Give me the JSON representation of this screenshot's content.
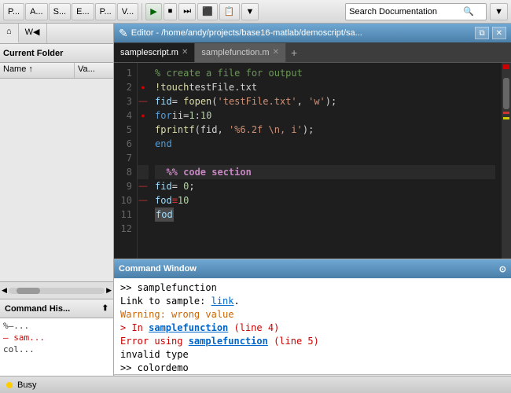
{
  "toolbar": {
    "tabs": [
      "P...",
      "A...",
      "S...",
      "E...",
      "P...",
      "V..."
    ],
    "run_label": "▶",
    "search_placeholder": "Search Documentation",
    "search_icon": "🔍"
  },
  "sidebar": {
    "tab1": "⌂",
    "tab2": "W◀",
    "header": "Current Folder",
    "col_name": "Name ↑",
    "col_val": "Va...",
    "files": [],
    "history_title": "Command His...",
    "history_items": [
      {
        "text": "%–...",
        "type": "normal"
      },
      {
        "text": "sam...",
        "type": "error"
      },
      {
        "text": "col...",
        "type": "normal"
      }
    ]
  },
  "editor": {
    "title": "Editor - /home/andy/projects/base16-matlab/demoscript/sa...",
    "tabs": [
      {
        "label": "samplescript.m",
        "active": true
      },
      {
        "label": "samplefunction.m",
        "active": false
      }
    ],
    "lines": [
      {
        "num": 1,
        "marker": "none",
        "code": "<span class='c-comment'>% create a file for output</span>"
      },
      {
        "num": 2,
        "marker": "red-dot",
        "code": "  <span class='c-builtin'>!touch</span> testFile.txt"
      },
      {
        "num": 3,
        "marker": "red-line",
        "code": "  <span class='c-var'>fid</span> = <span class='c-builtin'>fopen</span>(<span class='c-string'>'testFile.txt'</span>, <span class='c-string'>'w'</span>);"
      },
      {
        "num": 4,
        "marker": "red-dot",
        "code": "  <span class='c-keyword'>for</span> ii=<span class='c-number'>1</span>:<span class='c-number'>10</span>"
      },
      {
        "num": 5,
        "marker": "none",
        "code": "      <span class='c-builtin'>fprintf</span>(fid, <span class='c-string'>'%6.2f \\n, i</span>);"
      },
      {
        "num": 6,
        "marker": "none",
        "code": "  <span class='c-keyword'>end</span>"
      },
      {
        "num": 7,
        "marker": "none",
        "code": ""
      },
      {
        "num": 8,
        "marker": "none",
        "code": ""
      },
      {
        "num": 9,
        "marker": "red-line",
        "code": "  <span class='c-var'>fid</span> = <span class='c-number'>0</span>;"
      },
      {
        "num": 10,
        "marker": "red-line",
        "code": "  <span class='c-var'>fod</span> <span style='color:#cc3333'>≡</span> <span class='c-number'>10</span>"
      },
      {
        "num": 11,
        "marker": "none",
        "code": "  <span class='c-var'>fod</span>"
      },
      {
        "num": 12,
        "marker": "none",
        "code": ""
      }
    ]
  },
  "command_window": {
    "title": "Command Window",
    "lines": [
      {
        "type": "prompt",
        "text": ">> samplefunction"
      },
      {
        "type": "normal",
        "text": "Link to sample: "
      },
      {
        "type": "link",
        "link_text": "link",
        "suffix": "."
      },
      {
        "type": "warning",
        "text": "Warning: wrong value"
      },
      {
        "type": "error",
        "text": "> In "
      },
      {
        "type": "prompt",
        "text": ">> colordemo"
      }
    ]
  },
  "statusbar": {
    "status": "Busy"
  }
}
